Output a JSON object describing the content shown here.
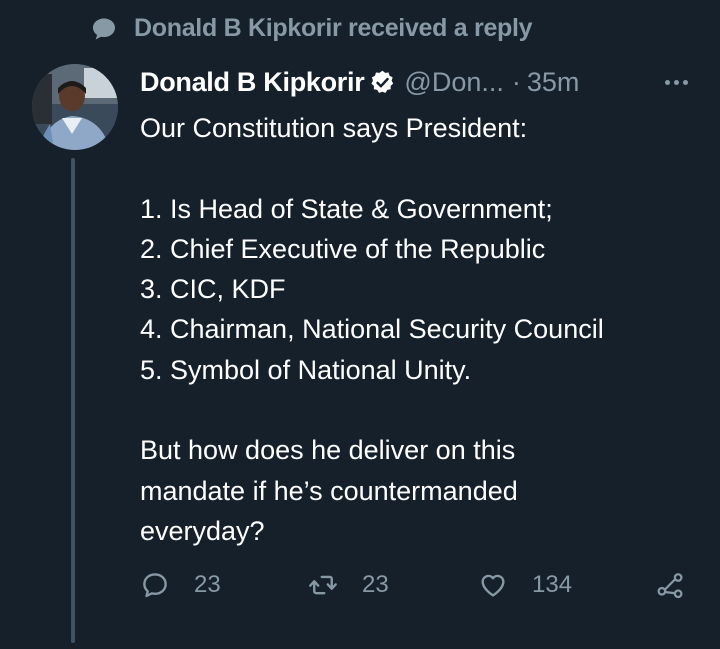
{
  "context": {
    "text": "Donald B Kipkorir received a reply",
    "icon": "speech-bubble-icon"
  },
  "tweet": {
    "author_name": "Donald B Kipkorir",
    "verified": true,
    "handle": "@Don...",
    "separator": "·",
    "time": "35m",
    "body": {
      "intro": "Our Constitution says President:",
      "list": [
        "1. Is Head of State & Government;",
        "2. Chief Executive of the Republic",
        "3. CIC, KDF",
        "4. Chairman, National Security Council",
        "5. Symbol of National Unity."
      ],
      "closing": [
        "But how does he deliver on this",
        "mandate if he’s countermanded",
        "everyday?"
      ]
    },
    "actions": {
      "replies": "23",
      "retweets": "23",
      "likes": "134"
    }
  },
  "colors": {
    "background": "#15202b",
    "secondary_text": "#8899a6",
    "primary_text": "#ffffff",
    "thread_line": "#3d5466"
  }
}
